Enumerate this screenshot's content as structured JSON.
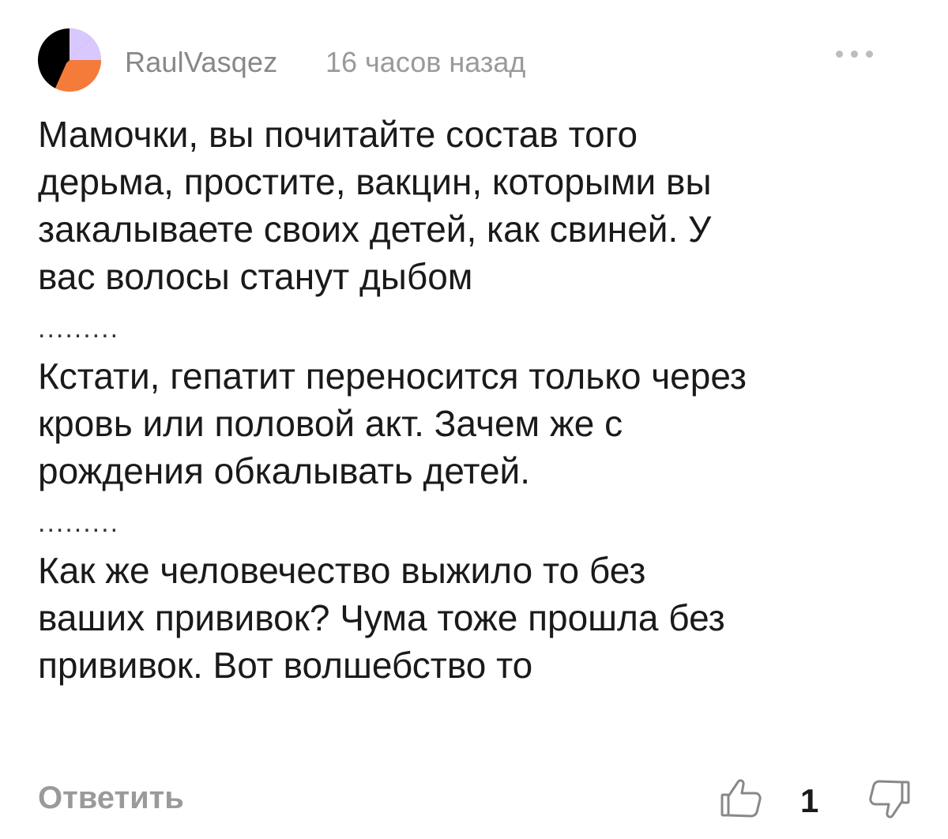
{
  "comment": {
    "author": "RaulVasqez",
    "time": "16 часов назад",
    "avatar_colors": {
      "left": "#000000",
      "top_right": "#d9c7ff",
      "bottom_right": "#f47b3a"
    },
    "more_icon": "ellipsis-icon",
    "paragraphs": [
      "Мамочки, вы почитайте состав того\nдерьма, простите, вакцин, которыми вы\nзакалываете своих детей, как свиней. У\nвас волосы станут дыбом",
      "Кстати, гепатит переносится только через\nкровь или половой акт. Зачем же с\nрождения обкалывать детей.",
      "Как же человечество выжило то без\nваших прививок? Чума тоже прошла без\nпрививок. Вот волшебство то"
    ],
    "separator": "........."
  },
  "footer": {
    "reply_label": "Ответить",
    "like_count": "1",
    "like_icon": "thumbs-up-icon",
    "dislike_icon": "thumbs-down-icon"
  }
}
